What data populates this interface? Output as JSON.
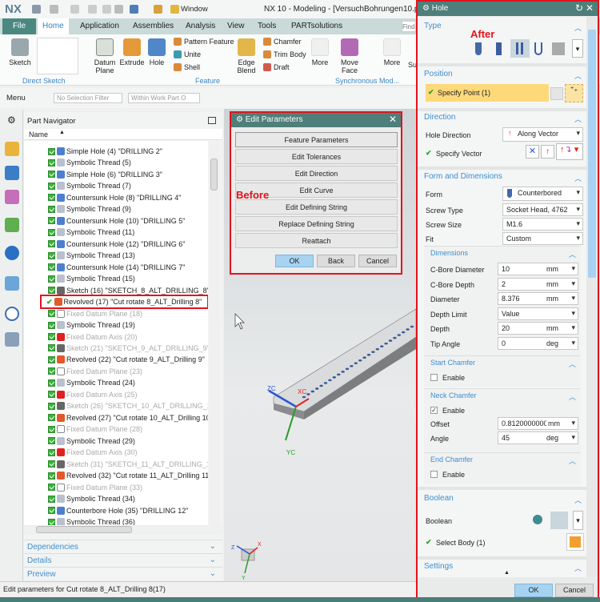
{
  "app": {
    "logo": "NX",
    "title": "NX 10 - Modeling - [VersuchBohrungen10.prt (Mo",
    "window_menu": "Window"
  },
  "tabs": [
    "File",
    "Home",
    "Application",
    "Assemblies",
    "Analysis",
    "View",
    "Tools",
    "PARTsolutions"
  ],
  "find_placeholder": "Find",
  "ribbon": {
    "sketch": "Sketch",
    "direct_sketch": "Direct Sketch",
    "datum_plane": "Datum Plane",
    "extrude": "Extrude",
    "hole": "Hole",
    "pattern_feature": "Pattern Feature",
    "unite": "Unite",
    "shell": "Shell",
    "edge_blend": "Edge Blend",
    "chamfer": "Chamfer",
    "trim_body": "Trim Body",
    "draft": "Draft",
    "more": "More",
    "feature": "Feature",
    "move_face": "Move Face",
    "more2": "More",
    "sync": "Synchronous Mod...",
    "su": "Su"
  },
  "toolbar": {
    "menu": "Menu",
    "filter": "No Selection Filter",
    "scope": "Within Work Part O"
  },
  "navigator": {
    "title": "Part Navigator",
    "column": "Name",
    "rows": [
      {
        "text": "Simple Hole (4) \"DRILLING 2\"",
        "icon": "hole",
        "gray": false
      },
      {
        "text": "Symbolic Thread (5)",
        "icon": "thread",
        "gray": false
      },
      {
        "text": "Simple Hole (6) \"DRILLING 3\"",
        "icon": "hole",
        "gray": false
      },
      {
        "text": "Symbolic Thread (7)",
        "icon": "thread",
        "gray": false
      },
      {
        "text": "Countersunk Hole (8) \"DRILLING 4\"",
        "icon": "hole",
        "gray": false
      },
      {
        "text": "Symbolic Thread (9)",
        "icon": "thread",
        "gray": false
      },
      {
        "text": "Countersunk Hole (10) \"DRILLING 5\"",
        "icon": "hole",
        "gray": false
      },
      {
        "text": "Symbolic Thread (11)",
        "icon": "thread",
        "gray": false
      },
      {
        "text": "Countersunk Hole (12) \"DRILLING 6\"",
        "icon": "hole",
        "gray": false
      },
      {
        "text": "Symbolic Thread (13)",
        "icon": "thread",
        "gray": false
      },
      {
        "text": "Countersunk Hole (14) \"DRILLING 7\"",
        "icon": "hole",
        "gray": false
      },
      {
        "text": "Symbolic Thread (15)",
        "icon": "thread",
        "gray": false
      },
      {
        "text": "Sketch (16) \"SKETCH_8_ALT_DRILLING_8\"",
        "icon": "sketch",
        "gray": false
      },
      {
        "text": "Revolved (17) \"Cut rotate 8_ALT_Drilling 8\"",
        "icon": "revolve",
        "gray": false,
        "selected": true
      },
      {
        "text": "Fixed Datum Plane (18)",
        "icon": "plane",
        "gray": true
      },
      {
        "text": "Symbolic Thread (19)",
        "icon": "thread",
        "gray": false
      },
      {
        "text": "Fixed Datum Axis (20)",
        "icon": "axis",
        "gray": true
      },
      {
        "text": "Sketch (21) \"SKETCH_9_ALT_DRILLING_9\"",
        "icon": "sketch",
        "gray": true
      },
      {
        "text": "Revolved (22) \"Cut rotate 9_ALT_Drilling 9\"",
        "icon": "revolve",
        "gray": false
      },
      {
        "text": "Fixed Datum Plane (23)",
        "icon": "plane",
        "gray": true
      },
      {
        "text": "Symbolic Thread (24)",
        "icon": "thread",
        "gray": false
      },
      {
        "text": "Fixed Datum Axis (25)",
        "icon": "axis",
        "gray": true
      },
      {
        "text": "Sketch (26) \"SKETCH_10_ALT_DRILLING_10\"",
        "icon": "sketch",
        "gray": true
      },
      {
        "text": "Revolved (27) \"Cut rotate 10_ALT_Drilling 10\"",
        "icon": "revolve",
        "gray": false
      },
      {
        "text": "Fixed Datum Plane (28)",
        "icon": "plane",
        "gray": true
      },
      {
        "text": "Symbolic Thread (29)",
        "icon": "thread",
        "gray": false
      },
      {
        "text": "Fixed Datum Axis (30)",
        "icon": "axis",
        "gray": true
      },
      {
        "text": "Sketch (31) \"SKETCH_11_ALT_DRILLING_11\"",
        "icon": "sketch",
        "gray": true
      },
      {
        "text": "Revolved (32) \"Cut rotate 11_ALT_Drilling 11\"",
        "icon": "revolve",
        "gray": false
      },
      {
        "text": "Fixed Datum Plane (33)",
        "icon": "plane",
        "gray": true
      },
      {
        "text": "Symbolic Thread (34)",
        "icon": "thread",
        "gray": false
      },
      {
        "text": "Counterbore Hole (35) \"DRILLING 12\"",
        "icon": "hole",
        "gray": false
      },
      {
        "text": "Symbolic Thread (36)",
        "icon": "thread",
        "gray": false
      }
    ],
    "sections": [
      "Dependencies",
      "Details",
      "Preview"
    ]
  },
  "status": "Edit parameters for Cut rotate 8_ALT_Drilling 8(17)",
  "viewport": {
    "zc": "ZC",
    "xc": "XC",
    "yc": "YC",
    "z": "Z",
    "x": "X",
    "y": "Y"
  },
  "edit_params": {
    "title": "Edit Parameters",
    "note": "Before",
    "buttons": [
      "Feature Parameters",
      "Edit Tolerances",
      "Edit Direction",
      "Edit Curve",
      "Edit Defining String",
      "Replace Defining String",
      "Reattach"
    ],
    "ok": "OK",
    "back": "Back",
    "cancel": "Cancel"
  },
  "hole": {
    "title": "Hole",
    "note": "After",
    "type": "Type",
    "position": "Position",
    "specify_point": "Specify Point (1)",
    "direction": "Direction",
    "hole_direction_label": "Hole Direction",
    "hole_direction": "Along Vector",
    "specify_vector": "Specify Vector",
    "form_dims": "Form and Dimensions",
    "form_label": "Form",
    "form": "Counterbored",
    "screw_type_label": "Screw Type",
    "screw_type": "Socket Head, 4762",
    "screw_size_label": "Screw Size",
    "screw_size": "M1.6",
    "fit_label": "Fit",
    "fit": "Custom",
    "dimensions": "Dimensions",
    "dims": [
      {
        "label": "C-Bore Diameter",
        "value": "10",
        "unit": "mm"
      },
      {
        "label": "C-Bore Depth",
        "value": "2",
        "unit": "mm"
      },
      {
        "label": "Diameter",
        "value": "8.376",
        "unit": "mm"
      },
      {
        "label": "Depth Limit",
        "value": "Value",
        "unit": ""
      },
      {
        "label": "Depth",
        "value": "20",
        "unit": "mm"
      },
      {
        "label": "Tip Angle",
        "value": "0",
        "unit": "deg"
      }
    ],
    "start_chamfer": "Start Chamfer",
    "enable": "Enable",
    "start_enabled": false,
    "neck_chamfer": "Neck Chamfer",
    "neck_enabled": true,
    "offset_label": "Offset",
    "offset": "0.81200000000",
    "offset_unit": "mm",
    "angle_label": "Angle",
    "angle": "45",
    "angle_unit": "deg",
    "end_chamfer": "End Chamfer",
    "end_enabled": false,
    "boolean": "Boolean",
    "boolean_label": "Boolean",
    "select_body": "Select Body (1)",
    "settings": "Settings",
    "ok": "OK",
    "cancel": "Cancel"
  },
  "colors": {
    "accent": "#4f7f7a",
    "highlight": "#e3131b",
    "link": "#3e8fcf",
    "point_bg": "#fdd97a"
  }
}
